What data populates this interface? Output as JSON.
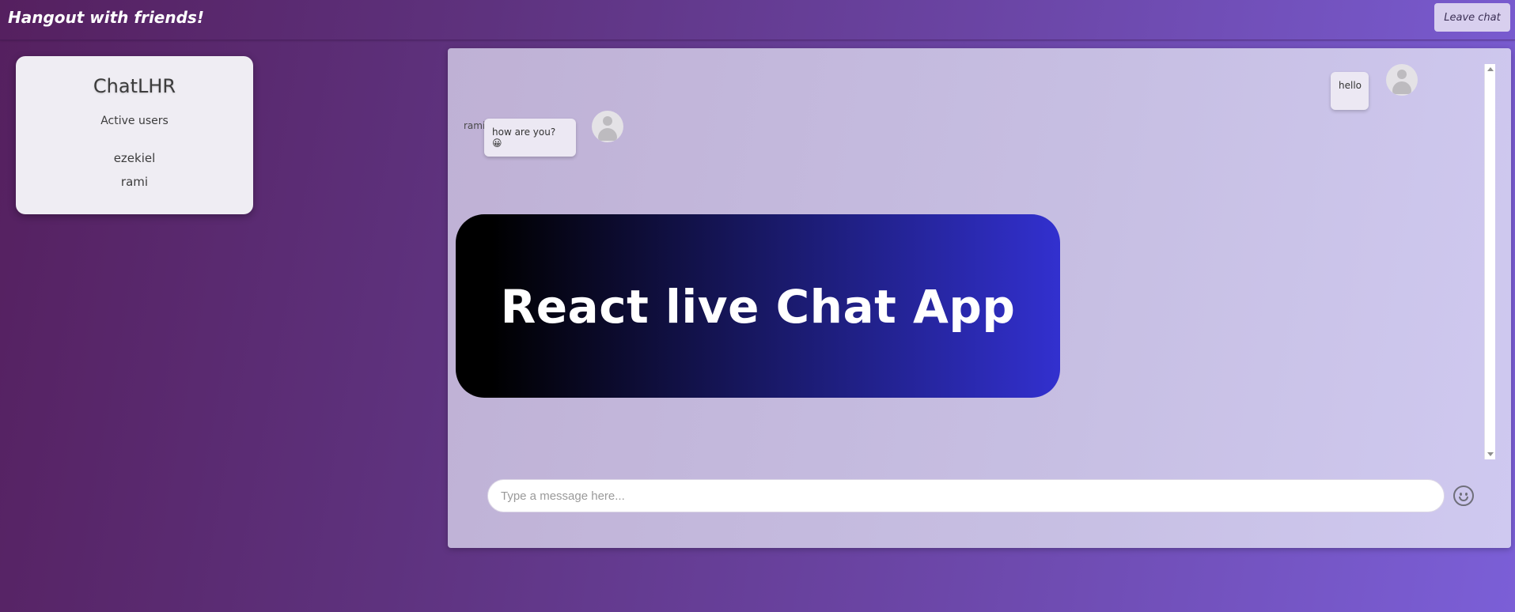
{
  "header": {
    "title": "Hangout with friends!",
    "leave_label": "Leave chat"
  },
  "sidebar": {
    "brand": "ChatLHR",
    "section_title": "Active users",
    "users": [
      "ezekiel",
      "rami"
    ]
  },
  "chat": {
    "messages": [
      {
        "sender": "",
        "text": "hello",
        "own": true
      },
      {
        "sender": "rami",
        "text": "how are you? 😀",
        "own": false
      }
    ],
    "banner_text": "React live Chat App",
    "input": {
      "value": "",
      "placeholder": "Type a message here..."
    },
    "emoji_icon": "smiley-face-icon",
    "avatar_icon": "user-avatar-icon"
  },
  "colors": {
    "background_start": "#55205f",
    "background_end": "#7b5fd7",
    "banner_start": "#000000",
    "banner_end": "#3230cf"
  }
}
